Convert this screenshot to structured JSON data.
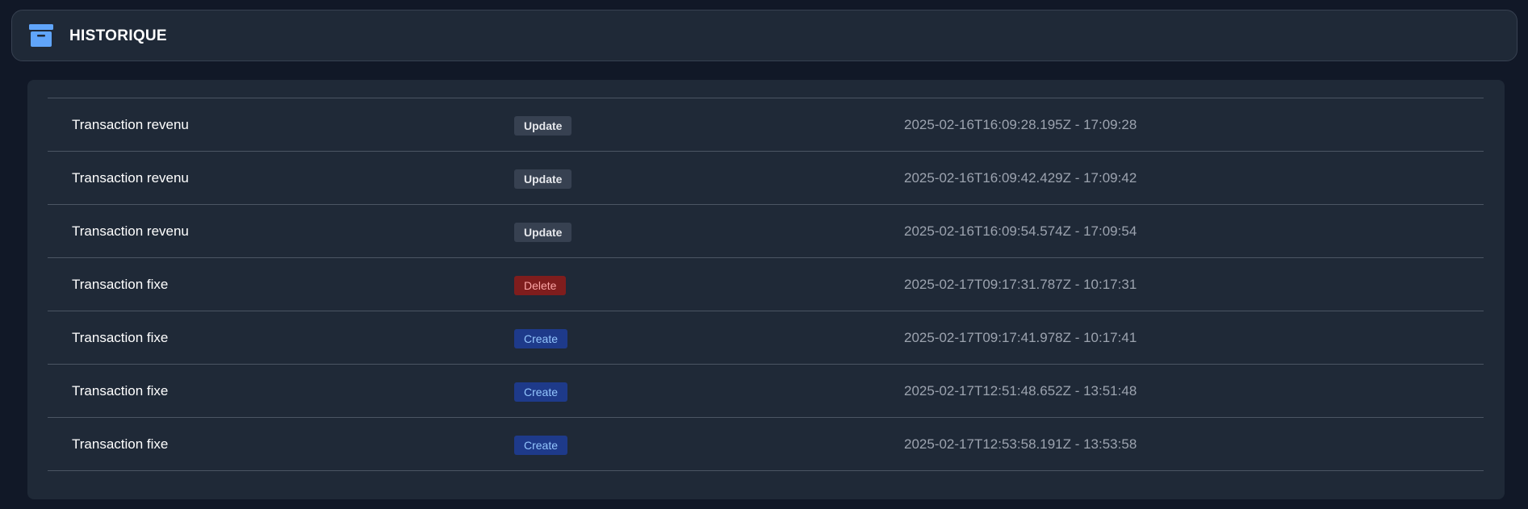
{
  "header": {
    "title": "HISTORIQUE",
    "icon": "archive-icon",
    "icon_color": "#60a5fa"
  },
  "history": [
    {
      "name": "Transaction revenu",
      "action": "Update",
      "action_type": "update",
      "timestamp": "2025-02-16T16:09:28.195Z - 17:09:28"
    },
    {
      "name": "Transaction revenu",
      "action": "Update",
      "action_type": "update",
      "timestamp": "2025-02-16T16:09:42.429Z - 17:09:42"
    },
    {
      "name": "Transaction revenu",
      "action": "Update",
      "action_type": "update",
      "timestamp": "2025-02-16T16:09:54.574Z - 17:09:54"
    },
    {
      "name": "Transaction fixe",
      "action": "Delete",
      "action_type": "delete",
      "timestamp": "2025-02-17T09:17:31.787Z - 10:17:31"
    },
    {
      "name": "Transaction fixe",
      "action": "Create",
      "action_type": "create",
      "timestamp": "2025-02-17T09:17:41.978Z - 10:17:41"
    },
    {
      "name": "Transaction fixe",
      "action": "Create",
      "action_type": "create",
      "timestamp": "2025-02-17T12:51:48.652Z - 13:51:48"
    },
    {
      "name": "Transaction fixe",
      "action": "Create",
      "action_type": "create",
      "timestamp": "2025-02-17T12:53:58.191Z - 13:53:58"
    }
  ],
  "colors": {
    "background": "#111827",
    "panel": "#1f2937",
    "update_badge": "#374151",
    "delete_badge": "#7f1d1d",
    "create_badge": "#1e3a8a"
  }
}
